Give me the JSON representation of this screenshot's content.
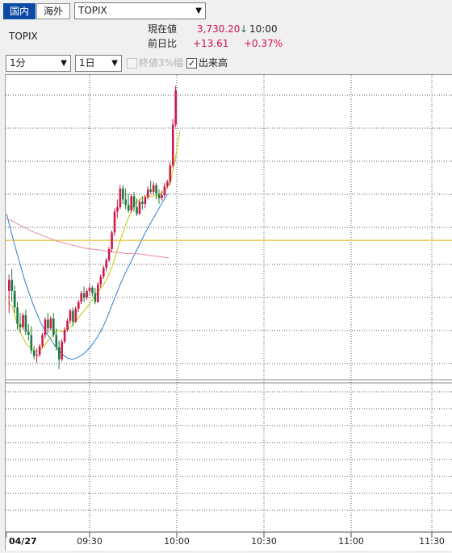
{
  "market_tabs": [
    {
      "label": "国内",
      "active": true
    },
    {
      "label": "海外",
      "active": false
    }
  ],
  "index_select": {
    "value": "TOPIX"
  },
  "instrument_name": "TOPIX",
  "quote": {
    "current_label": "現在値",
    "current_value": "3,730.20",
    "direction_icon": "down-arrow-icon",
    "direction_glyph": "↓",
    "time": "10:00",
    "change_label": "前日比",
    "change_value": "+13.61",
    "change_pct": "+0.37%"
  },
  "controls": {
    "interval_value": "1分",
    "period_value": "1日",
    "limit_label": "終値3%幅",
    "limit_checked": false,
    "volume_label": "出来高",
    "volume_checked": true
  },
  "colors": {
    "up_candle": "#cc1a4a",
    "down_candle": "#1e7a3c",
    "ma_short": "#c8c800",
    "ma_mid": "#2b7fd4",
    "ma_long": "#e58aa8",
    "reference_line": "#e2b100",
    "accent": "#0d4aa6"
  },
  "chart_data": {
    "type": "candlestick",
    "date_label": "04/27",
    "x_ticks": [
      "09:30",
      "10:00",
      "10:30",
      "11:00",
      "11:30"
    ],
    "candles": [
      [
        3712.0,
        3713.5,
        3710.0,
        3713.0
      ],
      [
        3713.0,
        3714.0,
        3711.0,
        3712.0
      ],
      [
        3712.0,
        3712.5,
        3710.0,
        3710.5
      ],
      [
        3710.5,
        3711.0,
        3708.5,
        3709.0
      ],
      [
        3709.0,
        3710.0,
        3708.2,
        3708.7
      ],
      [
        3708.7,
        3710.0,
        3708.5,
        3709.8
      ],
      [
        3709.8,
        3710.3,
        3708.0,
        3708.3
      ],
      [
        3708.3,
        3709.0,
        3707.5,
        3708.0
      ],
      [
        3708.0,
        3708.8,
        3706.3,
        3706.6
      ],
      [
        3706.6,
        3707.0,
        3705.8,
        3706.1
      ],
      [
        3706.1,
        3706.8,
        3705.5,
        3706.2
      ],
      [
        3706.2,
        3707.2,
        3706.0,
        3707.0
      ],
      [
        3707.0,
        3708.2,
        3706.8,
        3708.0
      ],
      [
        3708.0,
        3709.6,
        3707.7,
        3709.4
      ],
      [
        3709.4,
        3710.0,
        3708.2,
        3708.6
      ],
      [
        3708.6,
        3709.7,
        3708.4,
        3709.5
      ],
      [
        3709.5,
        3710.0,
        3707.8,
        3708.0
      ],
      [
        3708.0,
        3708.6,
        3706.6,
        3706.9
      ],
      [
        3706.9,
        3707.5,
        3704.9,
        3705.8
      ],
      [
        3705.8,
        3707.6,
        3705.6,
        3707.4
      ],
      [
        3707.4,
        3708.7,
        3707.2,
        3708.5
      ],
      [
        3708.5,
        3709.5,
        3708.3,
        3709.3
      ],
      [
        3709.3,
        3710.4,
        3709.0,
        3710.2
      ],
      [
        3710.2,
        3710.5,
        3708.8,
        3709.2
      ],
      [
        3709.2,
        3710.6,
        3709.1,
        3710.4
      ],
      [
        3710.4,
        3711.2,
        3710.1,
        3711.0
      ],
      [
        3711.0,
        3712.0,
        3710.8,
        3711.8
      ],
      [
        3711.8,
        3712.4,
        3711.0,
        3711.4
      ],
      [
        3711.4,
        3712.2,
        3711.2,
        3712.0
      ],
      [
        3712.0,
        3712.6,
        3711.6,
        3712.3
      ],
      [
        3712.3,
        3712.5,
        3711.5,
        3711.8
      ],
      [
        3711.8,
        3712.3,
        3710.8,
        3711.0
      ],
      [
        3711.0,
        3712.8,
        3710.9,
        3712.6
      ],
      [
        3712.6,
        3713.5,
        3712.3,
        3713.3
      ],
      [
        3713.3,
        3714.3,
        3713.1,
        3714.1
      ],
      [
        3714.1,
        3715.0,
        3713.8,
        3714.8
      ],
      [
        3714.8,
        3716.0,
        3714.6,
        3715.8
      ],
      [
        3715.8,
        3717.5,
        3715.5,
        3717.3
      ],
      [
        3717.3,
        3719.5,
        3717.0,
        3719.2
      ],
      [
        3719.2,
        3720.3,
        3718.6,
        3719.6
      ],
      [
        3719.6,
        3721.6,
        3719.4,
        3721.3
      ],
      [
        3721.3,
        3721.6,
        3719.9,
        3720.3
      ],
      [
        3720.3,
        3721.3,
        3719.4,
        3719.8
      ],
      [
        3719.8,
        3720.8,
        3719.1,
        3719.3
      ],
      [
        3719.3,
        3720.8,
        3719.1,
        3720.6
      ],
      [
        3720.6,
        3721.0,
        3719.2,
        3719.6
      ],
      [
        3719.6,
        3720.4,
        3718.8,
        3719.0
      ],
      [
        3719.0,
        3720.3,
        3718.9,
        3720.1
      ],
      [
        3720.1,
        3720.6,
        3719.4,
        3719.9
      ],
      [
        3719.9,
        3720.7,
        3719.5,
        3720.5
      ],
      [
        3720.5,
        3721.5,
        3720.3,
        3721.2
      ],
      [
        3721.2,
        3722.0,
        3720.8,
        3721.0
      ],
      [
        3721.0,
        3721.9,
        3720.7,
        3721.6
      ],
      [
        3721.6,
        3721.8,
        3720.3,
        3720.8
      ],
      [
        3720.8,
        3721.2,
        3719.9,
        3720.4
      ],
      [
        3720.4,
        3721.1,
        3720.2,
        3720.7
      ],
      [
        3720.7,
        3721.8,
        3720.5,
        3721.5
      ],
      [
        3721.5,
        3722.1,
        3721.3,
        3721.9
      ],
      [
        3721.9,
        3723.7,
        3721.6,
        3723.4
      ],
      [
        3723.4,
        3727.6,
        3723.2,
        3727.1
      ],
      [
        3727.1,
        3730.6,
        3726.9,
        3730.2
      ]
    ],
    "reference_value": 3716.59,
    "moving_averages": [
      {
        "values": [
          3711.0,
          3710.5,
          3709.0,
          3708.0,
          3707.2,
          3706.8,
          3706.5,
          3706.6,
          3707.0,
          3707.6,
          3708.1,
          3708.4,
          3708.3,
          3708.4,
          3708.8,
          3709.3,
          3709.8,
          3710.3,
          3710.8,
          3711.4,
          3712.0,
          3712.5,
          3713.2,
          3714.2,
          3715.5,
          3716.8,
          3718.0,
          3719.0,
          3719.9,
          3720.3,
          3720.5,
          3720.6,
          3720.6,
          3720.7,
          3720.9,
          3721.2,
          3722.0,
          3724.0,
          3726.5
        ]
      },
      {
        "values": [
          3719.0,
          3717.5,
          3716.0,
          3714.6,
          3713.2,
          3712.0,
          3710.9,
          3709.9,
          3709.0,
          3708.3,
          3707.7,
          3707.1,
          3706.6,
          3706.2,
          3705.9,
          3705.8,
          3705.9,
          3706.1,
          3706.4,
          3706.8,
          3707.3,
          3707.9,
          3708.6,
          3709.5,
          3710.5,
          3711.5,
          3712.5,
          3713.4,
          3714.2,
          3715.0,
          3715.8,
          3716.6,
          3717.4,
          3718.1,
          3718.8,
          3719.5,
          3720.2,
          3720.8
        ]
      },
      {
        "values": [
          3718.6,
          3718.2,
          3717.8,
          3717.4,
          3717.1,
          3716.8,
          3716.5,
          3716.3,
          3716.1,
          3715.9,
          3715.8,
          3715.7,
          3715.6,
          3715.5,
          3715.4,
          3715.4,
          3715.3,
          3715.2,
          3715.1,
          3715.0
        ]
      }
    ]
  }
}
